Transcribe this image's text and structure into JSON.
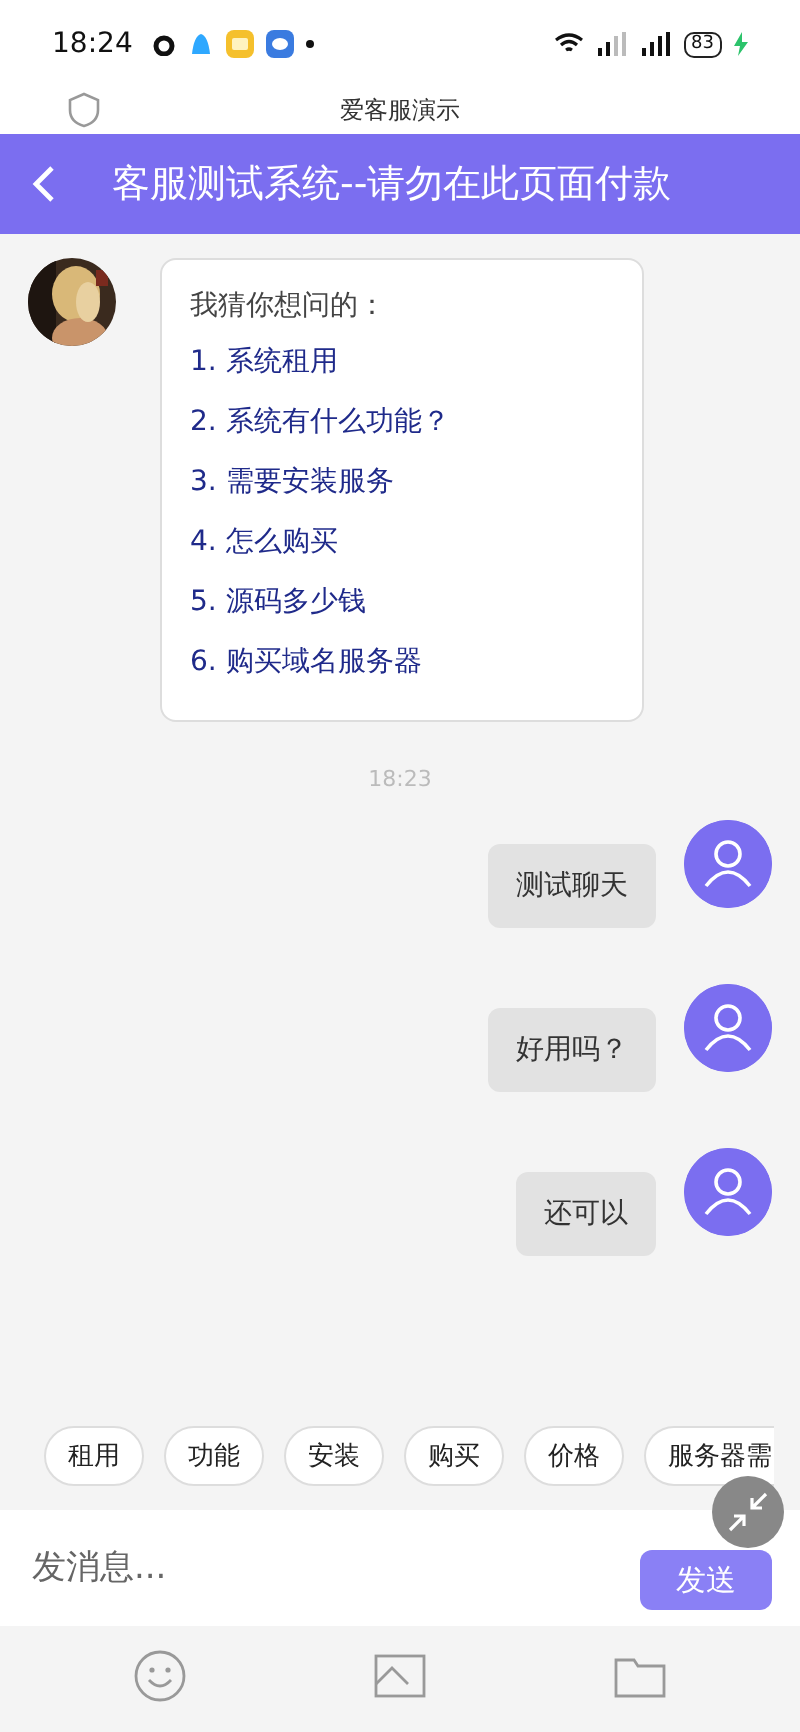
{
  "status_bar": {
    "time": "18:24",
    "battery": "83"
  },
  "browser_bar": {
    "title": "爱客服演示"
  },
  "header": {
    "title": "客服测试系统--请勿在此页面付款"
  },
  "bot_message": {
    "intro": "我猜你想问的：",
    "options": [
      "1. 系统租用",
      "2. 系统有什么功能？",
      "3. 需要安装服务",
      "4. 怎么购买",
      "5. 源码多少钱",
      "6. 购买域名服务器"
    ]
  },
  "timestamp": "18:23",
  "messages": [
    {
      "text": "测试聊天"
    },
    {
      "text": "好用吗？"
    },
    {
      "text": "还可以"
    }
  ],
  "quick_replies": [
    "租用",
    "功能",
    "安装",
    "购买",
    "价格",
    "服务器需"
  ],
  "input": {
    "placeholder": "发消息..."
  },
  "send_button": "发送"
}
